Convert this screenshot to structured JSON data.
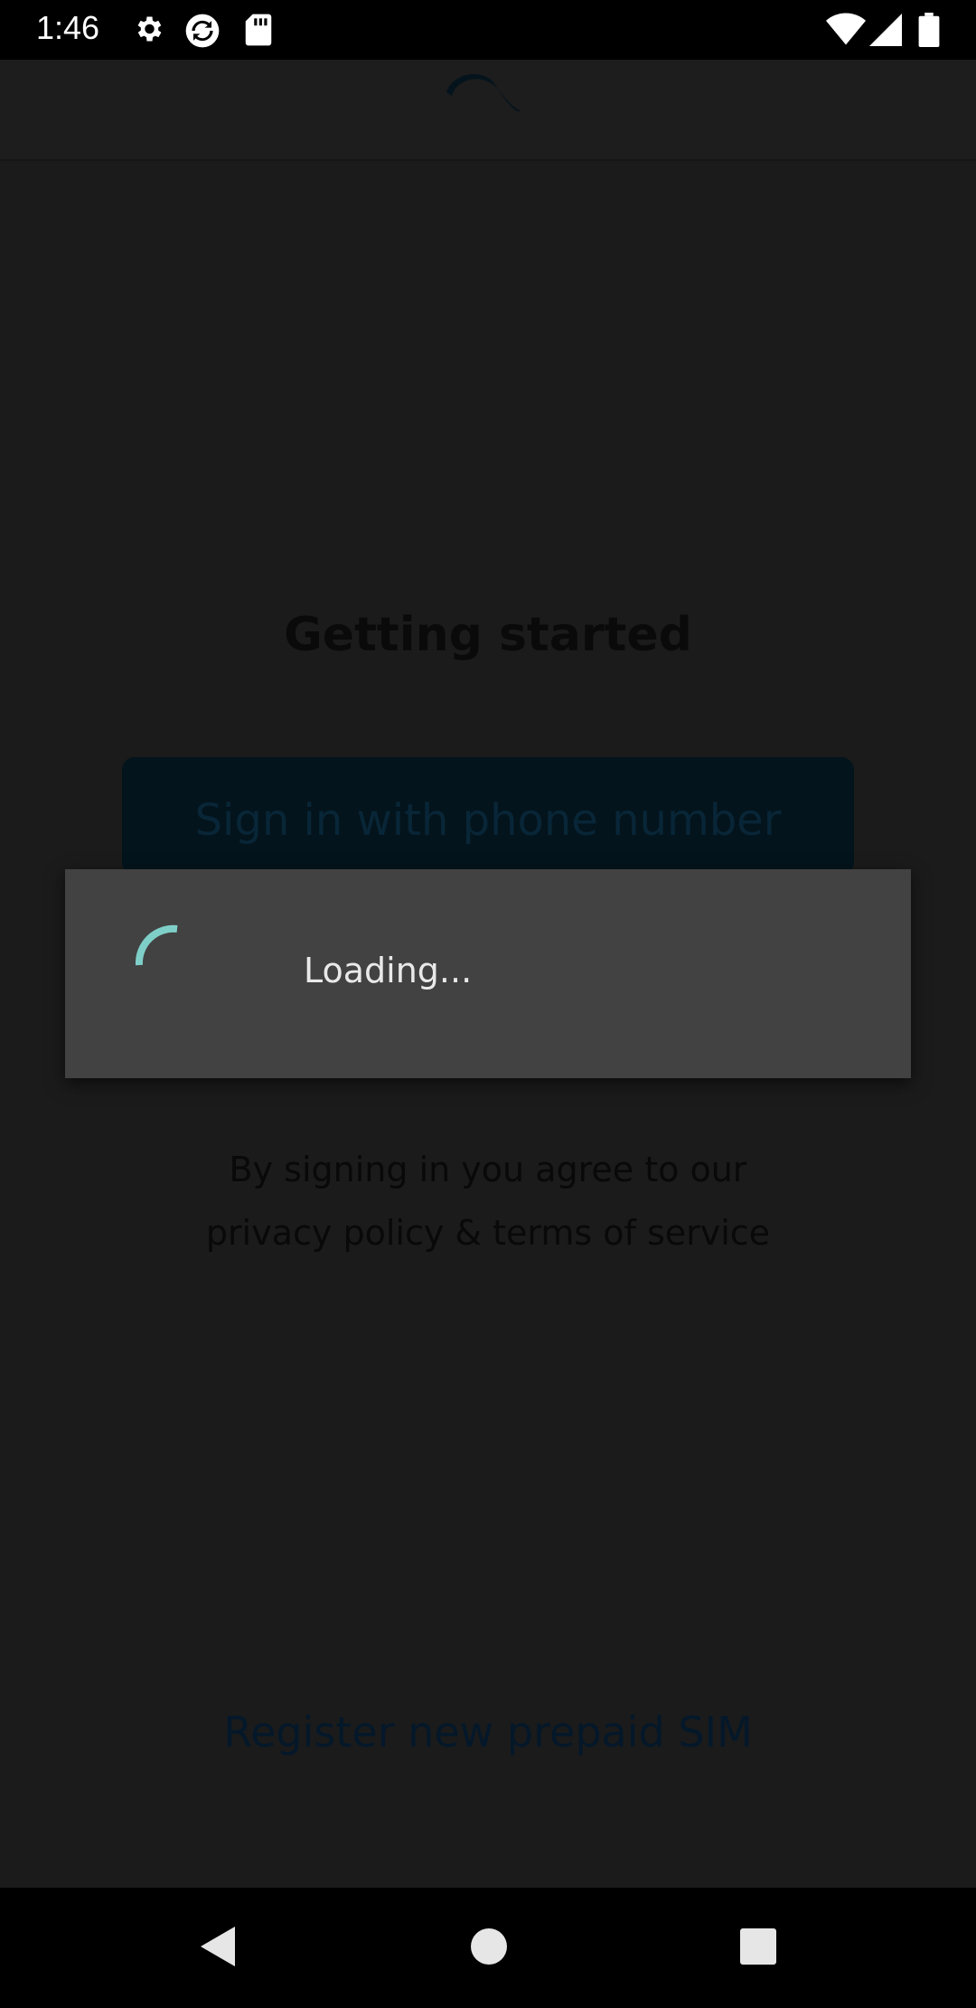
{
  "status_bar": {
    "time": "1:46",
    "icons": [
      "gear-icon",
      "sync-icon",
      "sd-card-icon",
      "wifi-icon",
      "signal-icon",
      "battery-icon"
    ]
  },
  "header": {
    "logo": "telenor-logo"
  },
  "main": {
    "title": "Getting started",
    "signin_button": "Sign in with phone number",
    "terms_line1": "By signing in you agree to our",
    "terms_line2": "privacy policy & terms of service",
    "register_link": "Register new prepaid SIM"
  },
  "dialog": {
    "text": "Loading..."
  },
  "colors": {
    "spinner": "#7fcfc9",
    "overlay_bg": "#1b1b1b",
    "dialog_bg": "#424242"
  },
  "nav_bar": {
    "buttons": [
      "back-icon",
      "home-icon",
      "recents-icon"
    ]
  }
}
